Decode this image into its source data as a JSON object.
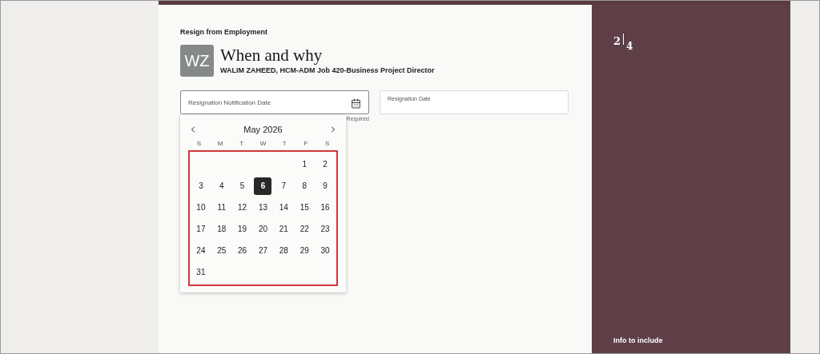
{
  "page_title": "Resign from Employment",
  "avatar": {
    "initials": "WZ"
  },
  "heading": "When and why",
  "subtitle": "WALIM ZAHEED, HCM-ADM Job 420-Business Project Director",
  "fields": [
    {
      "label": "Resignation Notification Date",
      "note": "Required",
      "kind": "date"
    },
    {
      "label": "Resignation Date",
      "kind": "text"
    }
  ],
  "calendar": {
    "month": "May 2026",
    "weekdays": [
      "S",
      "M",
      "T",
      "W",
      "T",
      "F",
      "S"
    ],
    "weeks": [
      [
        {
          "kind": "blank"
        },
        {
          "kind": "blank"
        },
        {
          "kind": "blank"
        },
        {
          "kind": "blank"
        },
        {
          "kind": "blank"
        },
        {
          "kind": "day",
          "day": "1",
          "selected": false
        },
        {
          "kind": "day",
          "day": "2",
          "selected": false
        }
      ],
      [
        {
          "kind": "day",
          "day": "3",
          "selected": false
        },
        {
          "kind": "day",
          "day": "4",
          "selected": false
        },
        {
          "kind": "day",
          "day": "5",
          "selected": false
        },
        {
          "kind": "day",
          "day": "6",
          "selected": true
        },
        {
          "kind": "day",
          "day": "7",
          "selected": false
        },
        {
          "kind": "day",
          "day": "8",
          "selected": false
        },
        {
          "kind": "day",
          "day": "9",
          "selected": false
        }
      ],
      [
        {
          "kind": "day",
          "day": "10",
          "selected": false
        },
        {
          "kind": "day",
          "day": "11",
          "selected": false
        },
        {
          "kind": "day",
          "day": "12",
          "selected": false
        },
        {
          "kind": "day",
          "day": "13",
          "selected": false
        },
        {
          "kind": "day",
          "day": "14",
          "selected": false
        },
        {
          "kind": "day",
          "day": "15",
          "selected": false
        },
        {
          "kind": "day",
          "day": "16",
          "selected": false
        }
      ],
      [
        {
          "kind": "day",
          "day": "17",
          "selected": false
        },
        {
          "kind": "day",
          "day": "18",
          "selected": false
        },
        {
          "kind": "day",
          "day": "19",
          "selected": false
        },
        {
          "kind": "day",
          "day": "20",
          "selected": false
        },
        {
          "kind": "day",
          "day": "21",
          "selected": false
        },
        {
          "kind": "day",
          "day": "22",
          "selected": false
        },
        {
          "kind": "day",
          "day": "23",
          "selected": false
        }
      ],
      [
        {
          "kind": "day",
          "day": "24",
          "selected": false
        },
        {
          "kind": "day",
          "day": "25",
          "selected": false
        },
        {
          "kind": "day",
          "day": "26",
          "selected": false
        },
        {
          "kind": "day",
          "day": "27",
          "selected": false
        },
        {
          "kind": "day",
          "day": "28",
          "selected": false
        },
        {
          "kind": "day",
          "day": "29",
          "selected": false
        },
        {
          "kind": "day",
          "day": "30",
          "selected": false
        }
      ],
      [
        {
          "kind": "day",
          "day": "31",
          "selected": false
        },
        {
          "kind": "blank"
        },
        {
          "kind": "blank"
        },
        {
          "kind": "blank"
        },
        {
          "kind": "blank"
        },
        {
          "kind": "blank"
        },
        {
          "kind": "blank"
        }
      ]
    ]
  },
  "side_panel": {
    "step": "2",
    "total": "4",
    "footer": "Info to include"
  }
}
